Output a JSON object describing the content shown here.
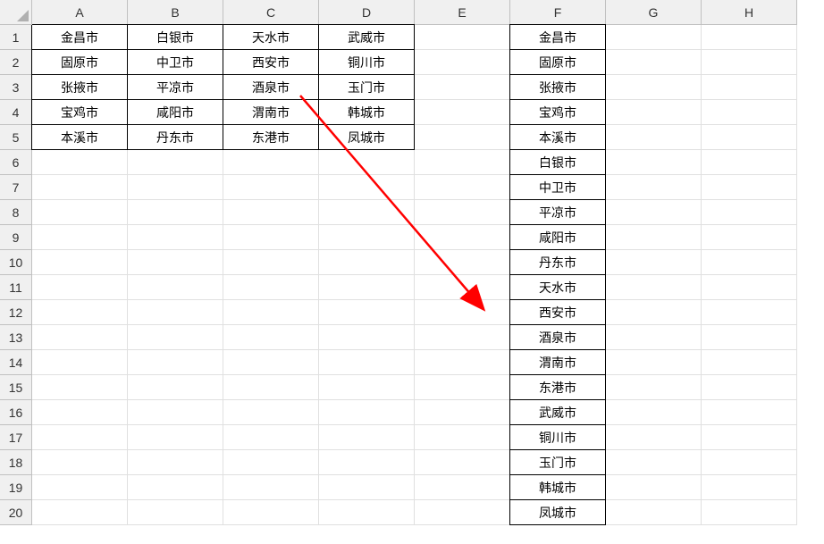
{
  "columns": [
    "A",
    "B",
    "C",
    "D",
    "E",
    "F",
    "G",
    "H"
  ],
  "rows": 20,
  "data_block": {
    "rows": [
      [
        "金昌市",
        "白银市",
        "天水市",
        "武威市"
      ],
      [
        "固原市",
        "中卫市",
        "西安市",
        "铜川市"
      ],
      [
        "张掖市",
        "平凉市",
        "酒泉市",
        "玉门市"
      ],
      [
        "宝鸡市",
        "咸阳市",
        "渭南市",
        "韩城市"
      ],
      [
        "本溪市",
        "丹东市",
        "东港市",
        "凤城市"
      ]
    ]
  },
  "column_f": [
    "金昌市",
    "固原市",
    "张掖市",
    "宝鸡市",
    "本溪市",
    "白银市",
    "中卫市",
    "平凉市",
    "咸阳市",
    "丹东市",
    "天水市",
    "西安市",
    "酒泉市",
    "渭南市",
    "东港市",
    "武威市",
    "铜川市",
    "玉门市",
    "韩城市",
    "凤城市"
  ],
  "arrow": {
    "from": {
      "col": "D",
      "row": 3
    },
    "to": {
      "col": "E_F_gap",
      "row": 12
    },
    "color": "#ff0000"
  }
}
